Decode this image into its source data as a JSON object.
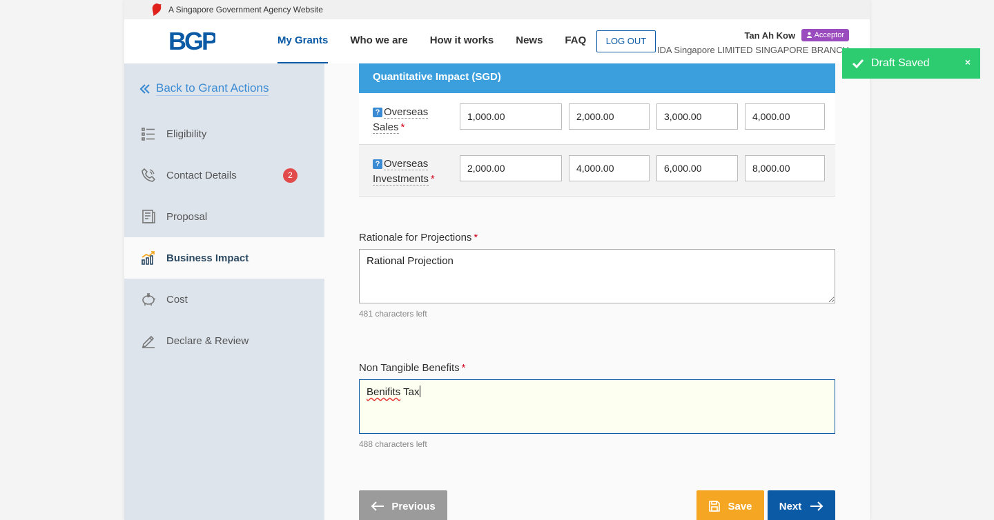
{
  "gov_bar": {
    "text": "A Singapore Government Agency Website"
  },
  "header": {
    "logo_text": "BGP",
    "nav": [
      "My Grants",
      "Who we are",
      "How it works",
      "News",
      "FAQ"
    ],
    "logout_label": "LOG OUT",
    "user_name": "Tan Ah Kow",
    "role": "Acceptor",
    "org": "IDA Singapore LIMITED SINGAPORE BRANCH"
  },
  "sidebar": {
    "back_label": "Back to Grant Actions",
    "items": [
      {
        "label": "Eligibility",
        "icon": "list-icon"
      },
      {
        "label": "Contact Details",
        "icon": "phone-icon",
        "badge": "2"
      },
      {
        "label": "Proposal",
        "icon": "document-icon"
      },
      {
        "label": "Business Impact",
        "icon": "chart-icon",
        "active": true
      },
      {
        "label": "Cost",
        "icon": "piggy-bank-icon"
      },
      {
        "label": "Declare & Review",
        "icon": "pen-icon"
      }
    ]
  },
  "quantitative": {
    "header": "Quantitative Impact (SGD)",
    "rows": [
      {
        "label_line1": "Overseas",
        "label_line2": "Sales",
        "values": [
          "1,000.00",
          "2,000.00",
          "3,000.00",
          "4,000.00"
        ]
      },
      {
        "label_line1": "Overseas",
        "label_line2": "Investments",
        "values": [
          "2,000.00",
          "4,000.00",
          "6,000.00",
          "8,000.00"
        ]
      }
    ]
  },
  "rationale": {
    "label": "Rationale for Projections",
    "value": "Rational Projection",
    "hint": "481 characters left"
  },
  "non_tangible": {
    "label": "Non Tangible Benefits",
    "value_word1": "Benifits",
    "value_word2": " Tax",
    "hint": "488 characters left"
  },
  "actions": {
    "previous": "Previous",
    "save": "Save",
    "next": "Next"
  },
  "toast": {
    "text": "Draft Saved",
    "close": "×"
  },
  "colors": {
    "primary": "#0b5aa5",
    "table_header": "#3b9fde",
    "save": "#f5a623",
    "toast": "#2ecc71",
    "role_badge": "#9a4bbd"
  }
}
